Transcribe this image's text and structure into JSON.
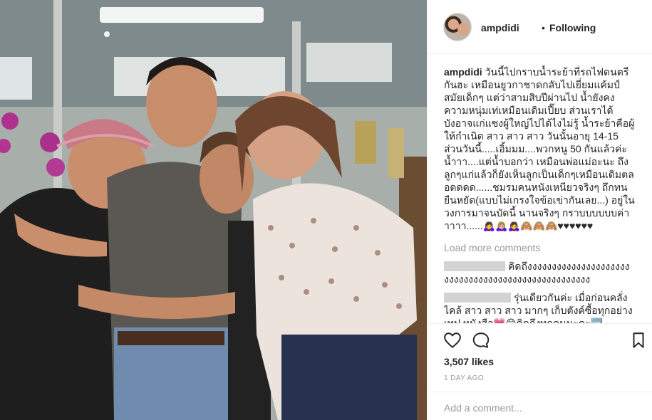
{
  "post": {
    "username": "ampdidi",
    "separator": "•",
    "follow_status": "Following"
  },
  "caption": {
    "username": "ampdidi",
    "text": "วันนี้ไปกราบน้ำระย้าที่รถไฟดนตรีกันฮะ เหมือนยูวกาชาดกลับไปเยี่ยมแค้มป์สมัยเด็กๆ แต่ว่าสามสิบปีผ่านไป น้ำยังคงความหนุ่มเท่เหมือนเดิมเปี๊ยบ ส่วนเราได้บังอาจแก่แซงผู้ใหญ่ไปได้ไงไม่รู้ น้ำระย้าคือผู้ให้กำเนิด สาว สาว สาว วันนั้นอายุ 14-15 ส่วนวันนี้.....เอิ้มมม....พวกหนู 50 กันแล้วค่ะน้ำาา....แต่น้ำบอกว่า เหมือนพ่อแม่อะนะ ถึงลูกๆแก่แล้วก็ยังเห็นลูกเป็นเด็กๆเหมือนเดิมตลอดดดด......ชมรมคนหนังเหนียวจริงๆ ถึกทนยืนหยัด(แบบไม่เกรงใจข้อเข่ากันเลย...) อยู่ในวงการมาจนบัดนี้ นานจริงๆ กราบบบบบบค่าาาาา......🙇‍♀️🙇🏼‍♀️🙇‍♀️🙈🙈🙈♥♥♥♥♥♥"
  },
  "load_more_label": "Load more comments",
  "comments": [
    {
      "text": "คิดถึงงงงงงงงงงงงงงงงงงงงงงงงงงงงงงงงงงงงงงงงงงงงงงงงงงง"
    },
    {
      "text": "รุ่นเดียวกันค่ะ เมื่อก่อนคลั่งไคล้ สาว สาว สาว มากๆ เก็บตังค์ซื้อทุกอย่าง เทป หนังสือ💗😄คิดถึงทุกคนนะคะ🆒"
    }
  ],
  "actions": {
    "like_icon": "heart-icon",
    "comment_icon": "speech-bubble-icon",
    "save_icon": "bookmark-icon"
  },
  "likes_text": "3,507 likes",
  "time_ago": "1 DAY AGO",
  "add_comment_placeholder": "Add a comment...",
  "colors": {
    "text": "#262626",
    "muted": "#999999",
    "border": "#efefef",
    "redaction": "#d3d3d3"
  }
}
